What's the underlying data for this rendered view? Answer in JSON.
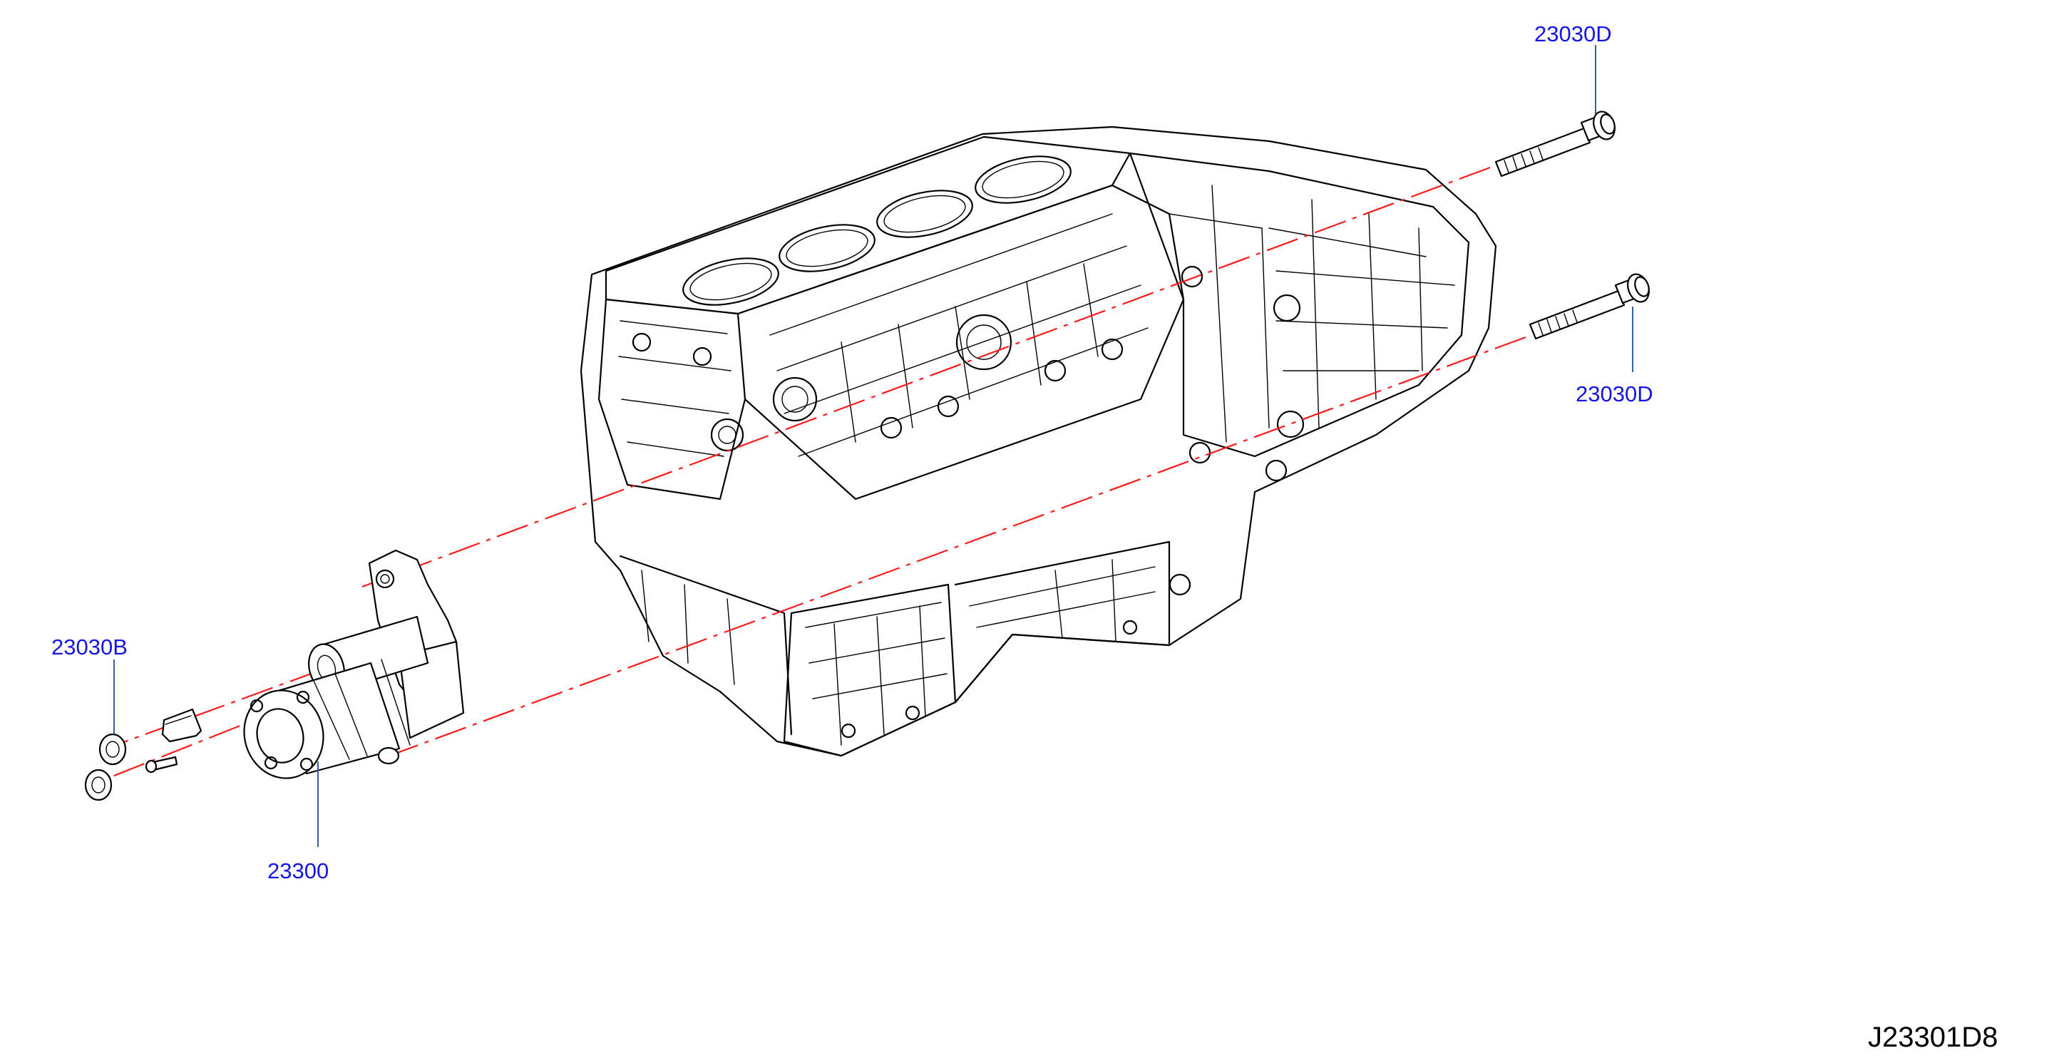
{
  "diagram_id": "J23301D8",
  "colors": {
    "callout": "#1515e6",
    "leader": "#3a5fa0",
    "center_line": "#ff1a1a",
    "ink": "#000000"
  },
  "callouts": {
    "bolt_upper": "23030D",
    "bolt_lower": "23030D",
    "nut": "23030B",
    "starter_motor": "23300"
  }
}
